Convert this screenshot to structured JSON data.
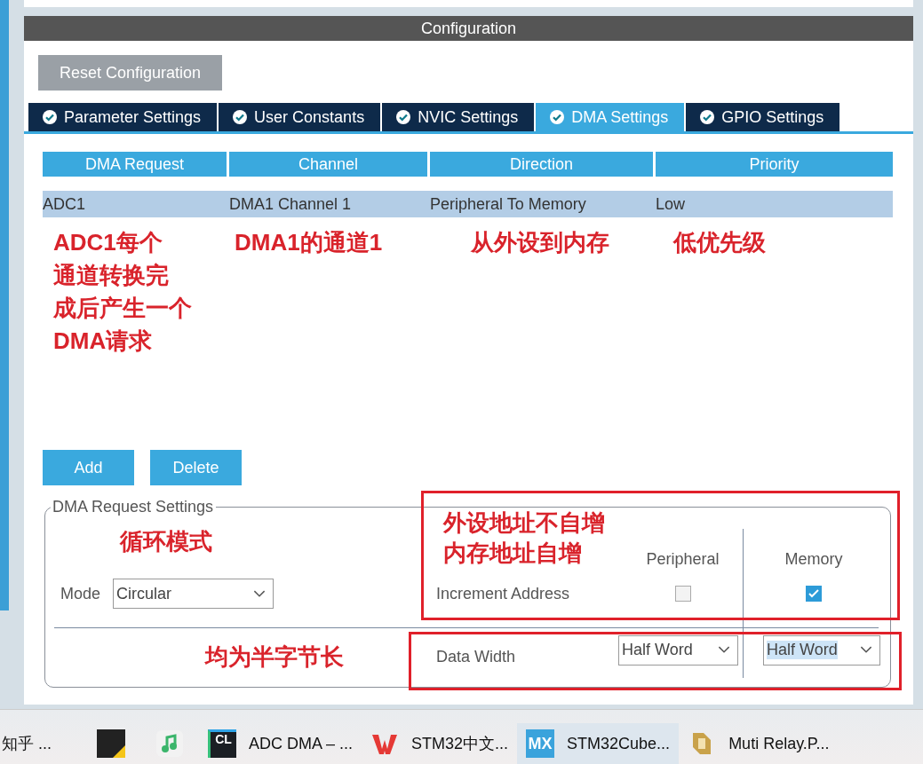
{
  "header": "Configuration",
  "reset_button": "Reset Configuration",
  "tabs": [
    {
      "label": "Parameter Settings",
      "selected": false
    },
    {
      "label": "User Constants",
      "selected": false
    },
    {
      "label": "NVIC Settings",
      "selected": false
    },
    {
      "label": "DMA Settings",
      "selected": true
    },
    {
      "label": "GPIO Settings",
      "selected": false
    }
  ],
  "table": {
    "columns": [
      "DMA Request",
      "Channel",
      "Direction",
      "Priority"
    ],
    "rows": [
      {
        "cells": [
          "ADC1",
          "DMA1 Channel 1",
          "Peripheral To Memory",
          "Low"
        ],
        "selected": true
      }
    ]
  },
  "column_notes": [
    {
      "lines": [
        "ADC1每个",
        "通道转换完",
        "成后产生一个",
        "DMA请求"
      ]
    },
    {
      "lines": [
        "DMA1的通道1"
      ]
    },
    {
      "lines": [
        "从外设到内存"
      ]
    },
    {
      "lines": [
        "低优先级"
      ]
    }
  ],
  "buttons": [
    "Add",
    "Delete"
  ],
  "settings": {
    "legend": "DMA Request Settings",
    "mode_note": "循环模式",
    "mode_label": "Mode",
    "mode_value": "Circular",
    "increment_note": [
      "外设地址不自增",
      "内存地址自增"
    ],
    "columns": [
      "Peripheral",
      "Memory"
    ],
    "increment_label": "Increment Address",
    "peripheral_increment": {
      "checked": false
    },
    "memory_increment": {
      "checked": true
    },
    "width_note": "均为半字节长",
    "data_width_label": "Data Width",
    "peripheral_width": {
      "value": "Half Word",
      "focused": false
    },
    "memory_width": {
      "value": "Half Word",
      "focused": true
    }
  },
  "taskbar": [
    {
      "label": "知乎 ...",
      "selected": false
    },
    {
      "selected": false
    },
    {
      "selected": false
    },
    {
      "label": "ADC  DMA – ...",
      "badge": "CL",
      "selected": false
    },
    {
      "label": "STM32中文...",
      "selected": false
    },
    {
      "label": "STM32Cube...",
      "badge": "MX",
      "selected": true
    },
    {
      "label": "Muti  Relay.P...",
      "selected": false
    }
  ]
}
